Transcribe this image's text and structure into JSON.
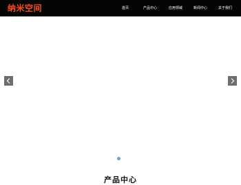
{
  "header": {
    "logo_text": "纳米空间",
    "nav": [
      "首页",
      "产品中心",
      "应用领域",
      "新闻中心",
      "关于我们"
    ]
  },
  "slider": {
    "prev_icon": "chevron-left-icon",
    "next_icon": "chevron-right-icon",
    "active_dot": 1,
    "dot_count": 1
  },
  "section": {
    "title": "产品中心"
  },
  "colors": {
    "topbar": "#050505",
    "logo": "#ff4d1c",
    "arrow_bg": "#6e6e6e",
    "dot": "#6a9fd4"
  }
}
